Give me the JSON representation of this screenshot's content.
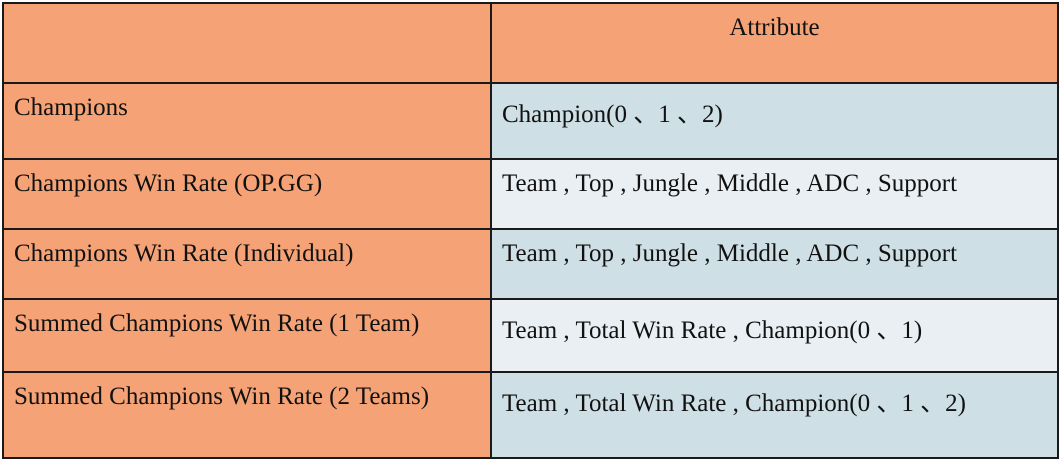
{
  "table": {
    "header": {
      "left": "",
      "right": "Attribute"
    },
    "rows": [
      {
        "name": "Champions",
        "attribute": "Champion(0 、1 、2)"
      },
      {
        "name": "Champions  Win Rate (OP.GG)",
        "attribute": "Team  , Top , Jungle , Middle ,  ADC , Support"
      },
      {
        "name": "Champions  Win Rate (Individual)",
        "attribute": "Team  , Top , Jungle , Middle ,  ADC , Support"
      },
      {
        "name": "Summed  Champions  Win Rate (1 Team)",
        "attribute": "Team  , Total Win Rate , Champion(0 、1)"
      },
      {
        "name": "Summed  Champions  Win Rate (2 Teams)",
        "attribute": "Team  , Total Win Rate , Champion(0 、1 、2)"
      }
    ]
  },
  "colors": {
    "name_column": "#f4a276",
    "attribute_dark": "#cfdfe6",
    "attribute_light": "#e9eff3",
    "border": "#1a1a1a"
  }
}
